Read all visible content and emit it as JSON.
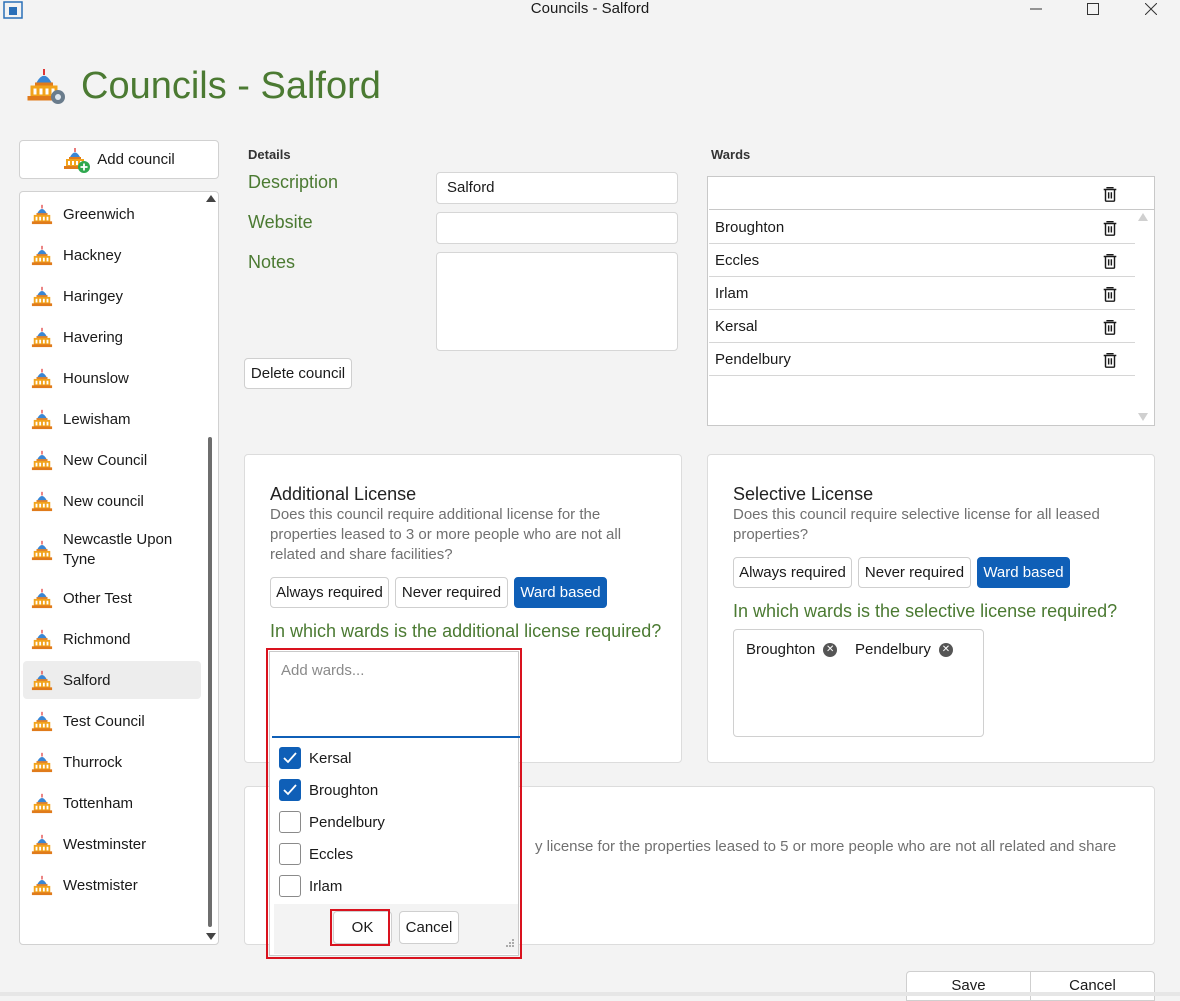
{
  "window": {
    "title": "Councils - Salford",
    "controls": [
      "minimize",
      "maximize",
      "close"
    ]
  },
  "header": {
    "title": "Councils - Salford"
  },
  "sidebar": {
    "add_label": "Add council",
    "items": [
      {
        "label": "Greenwich"
      },
      {
        "label": "Hackney"
      },
      {
        "label": "Haringey"
      },
      {
        "label": "Havering"
      },
      {
        "label": "Hounslow"
      },
      {
        "label": "Lewisham"
      },
      {
        "label": "New Council"
      },
      {
        "label": "New council"
      },
      {
        "label": "Newcastle Upon Tyne"
      },
      {
        "label": "Other Test"
      },
      {
        "label": "Richmond"
      },
      {
        "label": "Salford",
        "selected": true
      },
      {
        "label": "Test Council"
      },
      {
        "label": "Thurrock"
      },
      {
        "label": "Tottenham"
      },
      {
        "label": "Westminster"
      },
      {
        "label": "Westmister"
      }
    ]
  },
  "details": {
    "heading": "Details",
    "description_label": "Description",
    "description_value": "Salford",
    "website_label": "Website",
    "website_value": "",
    "notes_label": "Notes",
    "notes_value": "",
    "delete_label": "Delete council"
  },
  "wards": {
    "heading": "Wards",
    "new_value": "",
    "items": [
      "Broughton",
      "Eccles",
      "Irlam",
      "Kersal",
      "Pendelbury"
    ]
  },
  "additional_license": {
    "title": "Additional License",
    "description": "Does this council require additional license for the properties leased to 3 or more people who are not all related and share facilities?",
    "options": [
      "Always required",
      "Never required",
      "Ward based"
    ],
    "selected": "Ward based",
    "question": "In which wards is the additional license required?"
  },
  "selective_license": {
    "title": "Selective License",
    "description": "Does this council require selective license for all leased properties?",
    "options": [
      "Always required",
      "Never required",
      "Ward based"
    ],
    "selected": "Ward based",
    "question": "In which wards is the selective license required?",
    "chips": [
      "Broughton",
      "Pendelbury"
    ]
  },
  "mandatory_license": {
    "description_visible": "y license for the properties leased to 5 or more people who are not all related and share"
  },
  "ward_picker": {
    "placeholder": "Add wards...",
    "options": [
      {
        "label": "Kersal",
        "checked": true
      },
      {
        "label": "Broughton",
        "checked": true
      },
      {
        "label": "Pendelbury",
        "checked": false
      },
      {
        "label": "Eccles",
        "checked": false
      },
      {
        "label": "Irlam",
        "checked": false
      }
    ],
    "ok_label": "OK",
    "cancel_label": "Cancel"
  },
  "footer": {
    "save_label": "Save",
    "cancel_label": "Cancel"
  },
  "colors": {
    "accent": "#0f5fb7",
    "green_text": "#4b7a32",
    "highlight": "#d9121e"
  },
  "icons": [
    "app-icon",
    "council-building-icon",
    "trash-icon",
    "check-icon",
    "remove-chip-icon",
    "resize-grip-icon"
  ]
}
